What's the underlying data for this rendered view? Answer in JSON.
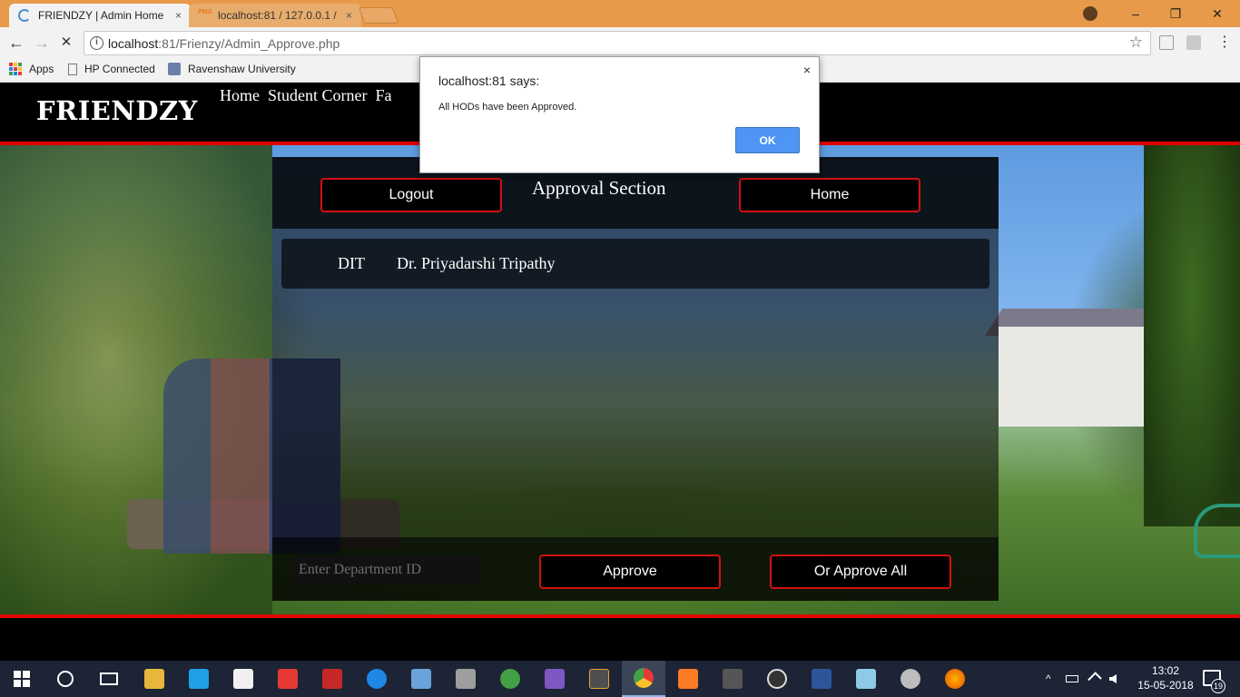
{
  "browser": {
    "tabs": [
      {
        "title": "FRIENDZY | Admin Home",
        "close": "×"
      },
      {
        "title": "localhost:81 / 127.0.0.1 /",
        "icon_text": "PMA",
        "close": "×"
      }
    ],
    "url_host": "localhost",
    "url_rest": ":81/Frienzy/Admin_Approve.php",
    "bookmarks": [
      "Apps",
      "HP Connected",
      "Ravenshaw University"
    ],
    "window_controls": {
      "minimize": "–",
      "restore": "❐",
      "close": "✕"
    },
    "nav": {
      "back": "←",
      "forward": "→",
      "stop": "✕"
    },
    "info_icon": "i",
    "star": "☆"
  },
  "site": {
    "brand": "FRIENDZY",
    "nav": [
      "Home",
      "Student Corner",
      "Fa"
    ]
  },
  "panel": {
    "logout_label": "Logout",
    "title": "Approval Section",
    "home_label": "Home",
    "rows": [
      {
        "dept": "DIT",
        "name": "Dr. Priyadarshi Tripathy"
      }
    ],
    "input_placeholder": "Enter Department ID",
    "approve_label": "Approve",
    "approve_all_label": "Or Approve All"
  },
  "dialog": {
    "title": "localhost:81 says:",
    "message": "All HODs have been Approved.",
    "ok_label": "OK",
    "close": "×"
  },
  "taskbar": {
    "time": "13:02",
    "date": "15-05-2018",
    "notification_count": "19",
    "tray_chevron": "^"
  },
  "colors": {
    "accent_red": "#e00000",
    "chrome_orange": "#e79a49",
    "dialog_button": "#4e95f4"
  }
}
